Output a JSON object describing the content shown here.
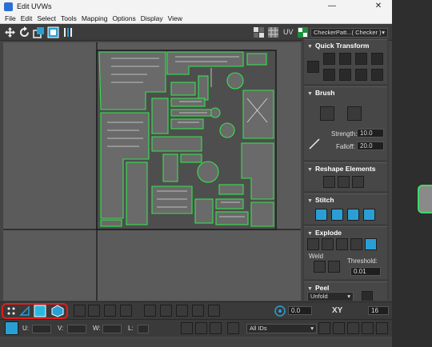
{
  "window": {
    "title": "Edit UVWs",
    "minimize_glyph": "—",
    "close_glyph": "✕"
  },
  "menu": [
    "File",
    "Edit",
    "Select",
    "Tools",
    "Mapping",
    "Options",
    "Display",
    "View"
  ],
  "toolbar": {
    "uv_label": "UV",
    "checker_label": "CheckerPatt...( Checker )"
  },
  "panel": {
    "quick_transform": {
      "title": "Quick Transform",
      "arrow": "▼"
    },
    "brush": {
      "title": "Brush",
      "arrow": "▼",
      "strength_label": "Strength:",
      "strength_value": "10.0",
      "falloff_label": "Falloff:",
      "falloff_value": "20.0"
    },
    "reshape": {
      "title": "Reshape Elements",
      "arrow": "▼"
    },
    "stitch": {
      "title": "Stitch",
      "arrow": "▼"
    },
    "explode": {
      "title": "Explode",
      "arrow": "▼",
      "weld_label": "Weld",
      "threshold_label": "Threshold:",
      "threshold_value": "0.01"
    },
    "peel": {
      "title": "Peel",
      "arrow": "▼",
      "unfold_value": "Unfold"
    }
  },
  "bottom": {
    "angle_value": "0.0",
    "xy_label": "XY",
    "grid_value": "16",
    "u_label": "U:",
    "v_label": "V:",
    "w_label": "W:",
    "l_label": "L:",
    "ids_value": "All IDs"
  },
  "colors": {
    "uv_edge": "#35e24f",
    "highlight_box": "#e01d1d",
    "accent_blue": "#2a9fd6"
  }
}
